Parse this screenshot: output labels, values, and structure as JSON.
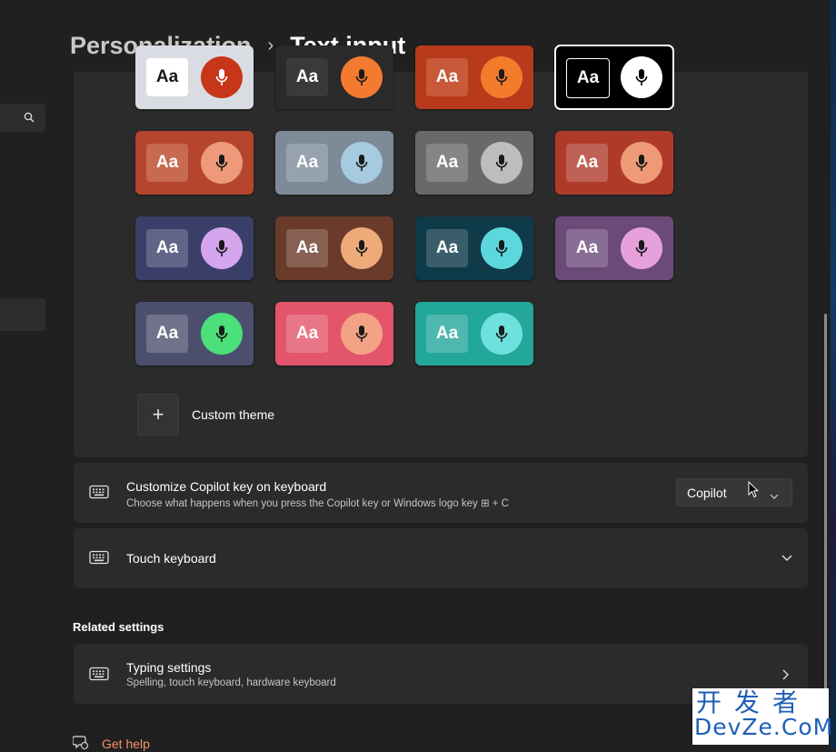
{
  "breadcrumb": {
    "parent": "Personalization",
    "separator": "›",
    "current": "Text input"
  },
  "themes": {
    "tiles": [
      {
        "aa": "Aa",
        "bg": "#d9dde3",
        "aa_bg": "#ffffff",
        "aa_color": "#1a1a1a",
        "mic_bg": "#c8361a",
        "mic_color": "#ffffff",
        "selected": false
      },
      {
        "aa": "Aa",
        "bg": "#2a2a2a",
        "aa_bg": "#3a3a3a",
        "aa_color": "#ffffff",
        "mic_bg": "#f37a2e",
        "mic_color": "#1a1a1a",
        "selected": false
      },
      {
        "aa": "Aa",
        "bg": "#b83a1d",
        "aa_bg": "#c85a3a",
        "aa_color": "#ffffff",
        "mic_bg": "#f47a2c",
        "mic_color": "#1a1a1a",
        "selected": false
      },
      {
        "aa": "Aa",
        "bg": "#000000",
        "aa_bg": "#000000",
        "aa_color": "#ffffff",
        "mic_bg": "#ffffff",
        "mic_color": "#000000",
        "selected": true
      },
      {
        "aa": "Aa",
        "bg": "#b5452d",
        "aa_bg": "#c86a52",
        "aa_color": "#ffffff",
        "mic_bg": "#ee9a7a",
        "mic_color": "#1a1a1a",
        "selected": false
      },
      {
        "aa": "Aa",
        "bg": "#7d8a97",
        "aa_bg": "#96a2ad",
        "aa_color": "#ffffff",
        "mic_bg": "#a6cadf",
        "mic_color": "#1a1a1a",
        "selected": false
      },
      {
        "aa": "Aa",
        "bg": "#696969",
        "aa_bg": "#858585",
        "aa_color": "#ffffff",
        "mic_bg": "#bdbdbd",
        "mic_color": "#1a1a1a",
        "selected": false
      },
      {
        "aa": "Aa",
        "bg": "#b03a2a",
        "aa_bg": "rgba(255,255,255,0.2)",
        "aa_color": "#ffffff",
        "mic_bg": "#ef9a77",
        "mic_color": "#1a1a1a",
        "selected": false
      },
      {
        "aa": "Aa",
        "bg": "#3a3f6a",
        "aa_bg": "rgba(255,255,255,0.2)",
        "aa_color": "#ffffff",
        "mic_bg": "#d5a5ee",
        "mic_color": "#1a1a1a",
        "selected": false
      },
      {
        "aa": "Aa",
        "bg": "#6a3a2a",
        "aa_bg": "rgba(255,255,255,0.2)",
        "aa_color": "#ffffff",
        "mic_bg": "#edab7a",
        "mic_color": "#1a1a1a",
        "selected": false
      },
      {
        "aa": "Aa",
        "bg": "#0f3a4a",
        "aa_bg": "rgba(255,255,255,0.18)",
        "aa_color": "#ffffff",
        "mic_bg": "#5cd8dd",
        "mic_color": "#1a1a1a",
        "selected": false
      },
      {
        "aa": "Aa",
        "bg": "#6b4a7a",
        "aa_bg": "rgba(255,255,255,0.2)",
        "aa_color": "#ffffff",
        "mic_bg": "#e6a1dd",
        "mic_color": "#1a1a1a",
        "selected": false
      },
      {
        "aa": "Aa",
        "bg": "#4b4f6d",
        "aa_bg": "rgba(255,255,255,0.2)",
        "aa_color": "#ffffff",
        "mic_bg": "#4be07a",
        "mic_color": "#1a1a1a",
        "selected": false
      },
      {
        "aa": "Aa",
        "bg": "#e2556a",
        "aa_bg": "rgba(255,255,255,0.2)",
        "aa_color": "#ffffff",
        "mic_bg": "#f3a286",
        "mic_color": "#1a1a1a",
        "selected": false
      },
      {
        "aa": "Aa",
        "bg": "#22a79a",
        "aa_bg": "rgba(255,255,255,0.2)",
        "aa_color": "#ffffff",
        "mic_bg": "#6ee0dd",
        "mic_color": "#1a1a1a",
        "selected": false
      }
    ],
    "custom_theme_label": "Custom theme"
  },
  "copilot_setting": {
    "title": "Customize Copilot key on keyboard",
    "subtitle": "Choose what happens when you press the Copilot key or Windows logo key ⊞ + C",
    "dropdown_value": "Copilot"
  },
  "touch_keyboard": {
    "title": "Touch keyboard"
  },
  "related": {
    "heading": "Related settings",
    "typing_title": "Typing settings",
    "typing_subtitle": "Spelling, touch keyboard, hardware keyboard"
  },
  "help": {
    "label": "Get help"
  },
  "watermark": {
    "top": "开发者",
    "bottom": "DevZe.CoM"
  }
}
